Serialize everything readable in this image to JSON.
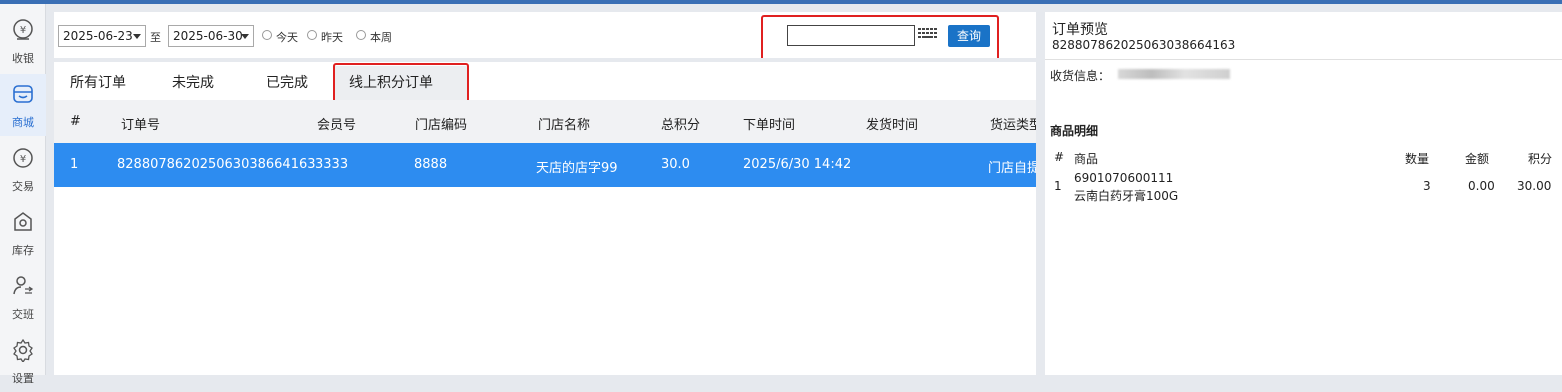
{
  "sidebar": {
    "items": [
      {
        "label": "收银",
        "icon": "cashier-icon"
      },
      {
        "label": "商城",
        "icon": "store-icon"
      },
      {
        "label": "交易",
        "icon": "yuan-icon"
      },
      {
        "label": "库存",
        "icon": "inventory-icon"
      },
      {
        "label": "交班",
        "icon": "shift-icon"
      },
      {
        "label": "设置",
        "icon": "gear-icon"
      }
    ],
    "active": 1
  },
  "filter": {
    "start_date": "2025-06-23",
    "to_label": "至",
    "end_date": "2025-06-30",
    "radio_today": "今天",
    "radio_yesterday": "昨天",
    "radio_week": "本周",
    "search_value": "",
    "query_label": "查询"
  },
  "tabs": [
    "所有订单",
    "未完成",
    "已完成",
    "线上积分订单"
  ],
  "active_tab": 3,
  "table": {
    "columns": [
      "#",
      "订单号",
      "会员号",
      "门店编码",
      "门店名称",
      "总积分",
      "下单时间",
      "发货时间",
      "货运类型"
    ],
    "rows": [
      [
        "1",
        "8288078620250630386641​63",
        "3333",
        "8888",
        "天店的店字99",
        "30.0",
        "2025/6/30 14:42",
        "",
        "门店自提"
      ]
    ]
  },
  "preview": {
    "title": "订单预览",
    "order_no": "828807862025063038664163",
    "ship_label": "收货信息：",
    "section_title": "商品明细",
    "columns": [
      "#",
      "商品",
      "数量",
      "金额",
      "积分"
    ],
    "items": [
      {
        "index": "1",
        "code": "6901070600111",
        "name": "云南白药牙膏100G",
        "qty": "3",
        "amount": "0.00",
        "points": "30.00"
      }
    ]
  },
  "colors": {
    "accent": "#2d8cf0",
    "button": "#1a73c7",
    "highlight_box": "#e02020"
  }
}
